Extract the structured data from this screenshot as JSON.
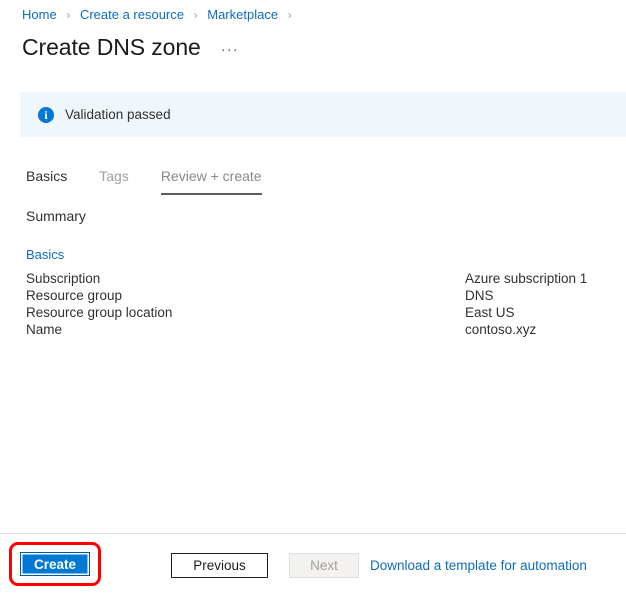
{
  "breadcrumb": {
    "separator": "›",
    "items": [
      {
        "label": "Home"
      },
      {
        "label": "Create a resource"
      },
      {
        "label": "Marketplace"
      }
    ]
  },
  "header": {
    "title": "Create DNS zone",
    "more_menu": "···"
  },
  "banner": {
    "icon": "info-icon",
    "glyph": "i",
    "text": "Validation passed",
    "background": "#eff6fc",
    "icon_color": "#0078d4"
  },
  "tabs": [
    {
      "label": "Basics",
      "state": "dark"
    },
    {
      "label": "Tags",
      "state": "muted"
    },
    {
      "label": "Review + create",
      "state": "active"
    }
  ],
  "main": {
    "summary_heading": "Summary",
    "section_link": "Basics",
    "rows": [
      {
        "key": "Subscription",
        "value": "Azure subscription 1"
      },
      {
        "key": "Resource group",
        "value": "DNS"
      },
      {
        "key": "Resource group location",
        "value": "East US"
      },
      {
        "key": "Name",
        "value": "contoso.xyz"
      }
    ]
  },
  "footer": {
    "create_label": "Create",
    "previous_label": "Previous",
    "next_label": "Next",
    "download_label": "Download a template for automation",
    "accent_color": "#0078d4",
    "link_color": "#0f6cbd",
    "highlight_color": "#ff0000"
  }
}
